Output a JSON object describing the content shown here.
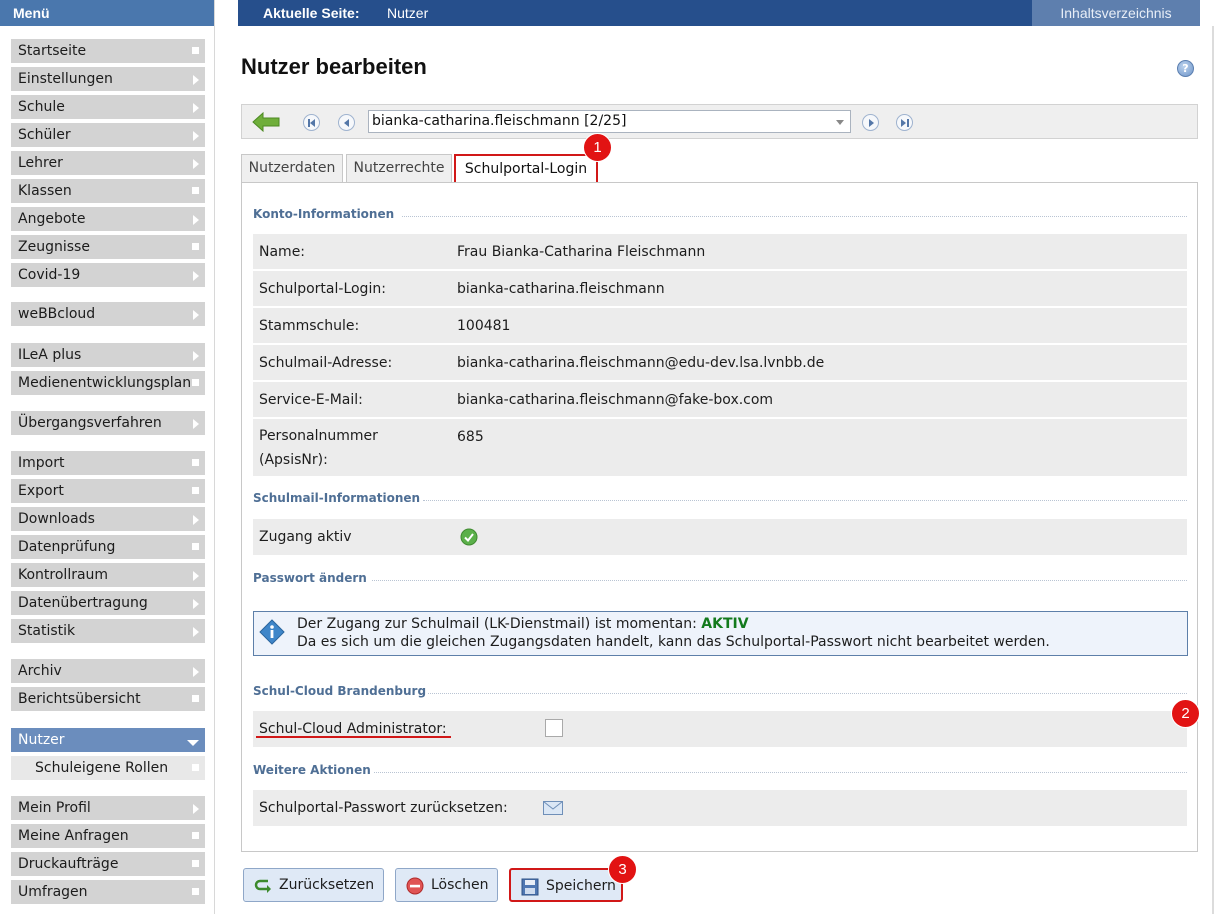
{
  "sidebar": {
    "title": "Menü",
    "groups": [
      [
        {
          "label": "Startseite",
          "marker": "square"
        },
        {
          "label": "Einstellungen",
          "marker": "chevron"
        },
        {
          "label": "Schule",
          "marker": "chevron"
        },
        {
          "label": "Schüler",
          "marker": "chevron"
        },
        {
          "label": "Lehrer",
          "marker": "chevron"
        },
        {
          "label": "Klassen",
          "marker": "square"
        },
        {
          "label": "Angebote",
          "marker": "chevron"
        },
        {
          "label": "Zeugnisse",
          "marker": "square"
        },
        {
          "label": "Covid-19",
          "marker": "chevron"
        }
      ],
      [
        {
          "label": "weBBcloud",
          "marker": "chevron"
        }
      ],
      [
        {
          "label": "ILeA plus",
          "marker": "chevron"
        },
        {
          "label": "Medienentwicklungsplan",
          "marker": "square"
        }
      ],
      [
        {
          "label": "Übergangsverfahren",
          "marker": "chevron"
        }
      ],
      [
        {
          "label": "Import",
          "marker": "square"
        },
        {
          "label": "Export",
          "marker": "square"
        },
        {
          "label": "Downloads",
          "marker": "chevron"
        },
        {
          "label": "Datenprüfung",
          "marker": "square"
        },
        {
          "label": "Kontrollraum",
          "marker": "chevron"
        },
        {
          "label": "Datenübertragung",
          "marker": "chevron"
        },
        {
          "label": "Statistik",
          "marker": "chevron"
        }
      ],
      [
        {
          "label": "Archiv",
          "marker": "chevron"
        },
        {
          "label": "Berichtsübersicht",
          "marker": "square"
        }
      ],
      [
        {
          "label": "Nutzer",
          "marker": "down",
          "active": true
        },
        {
          "label": "Schuleigene Rollen",
          "marker": "square",
          "sub": true
        }
      ],
      [
        {
          "label": "Mein Profil",
          "marker": "chevron"
        },
        {
          "label": "Meine Anfragen",
          "marker": "square"
        },
        {
          "label": "Druckaufträge",
          "marker": "square"
        },
        {
          "label": "Umfragen",
          "marker": "square"
        }
      ]
    ]
  },
  "topbar": {
    "current_label": "Aktuelle Seite:",
    "current_value": "Nutzer",
    "toc_label": "Inhaltsverzeichnis"
  },
  "page": {
    "title": "Nutzer bearbeiten",
    "help_glyph": "?"
  },
  "navigator": {
    "selected_user": "bianka-catharina.fleischmann [2/25]"
  },
  "tabs": [
    {
      "label": "Nutzerdaten"
    },
    {
      "label": "Nutzerrechte"
    },
    {
      "label": "Schulportal-Login"
    }
  ],
  "sections": {
    "konto": "Konto-Informationen",
    "schulmail": "Schulmail-Informationen",
    "passwort": "Passwort ändern",
    "cloud": "Schul-Cloud Brandenburg",
    "weitere": "Weitere Aktionen"
  },
  "konto_rows": [
    {
      "label": "Name:",
      "value": "Frau Bianka-Catharina Fleischmann"
    },
    {
      "label": "Schulportal-Login:",
      "value": "bianka-catharina.fleischmann"
    },
    {
      "label": "Stammschule:",
      "value": "100481"
    },
    {
      "label": "Schulmail-Adresse:",
      "value": "bianka-catharina.fleischmann@edu-dev.lsa.lvnbb.de"
    },
    {
      "label": "Service-E-Mail:",
      "value": "bianka-catharina.fleischmann@fake-box.com"
    },
    {
      "label_line1": "Personalnummer",
      "label_line2": "(ApsisNr):",
      "value": "685"
    }
  ],
  "schulmail": {
    "zugang_label": "Zugang aktiv"
  },
  "info": {
    "line1_prefix": "Der Zugang zur Schulmail (LK-Dienstmail) ist momentan:",
    "line1_status": "AKTIV",
    "line2": "Da es sich um die gleichen Zugangsdaten handelt, kann das Schulportal-Passwort nicht bearbeitet werden."
  },
  "cloud": {
    "admin_label": "Schul-Cloud Administrator:",
    "admin_checked": false
  },
  "weitere": {
    "reset_label": "Schulportal-Passwort zurücksetzen:"
  },
  "buttons": {
    "reset": "Zurücksetzen",
    "delete": "Löschen",
    "save": "Speichern"
  },
  "markers": [
    "1",
    "2",
    "3"
  ],
  "colors": {
    "accent_blue": "#264f8c",
    "highlight_red": "#d11818",
    "status_green": "#137a1d"
  }
}
